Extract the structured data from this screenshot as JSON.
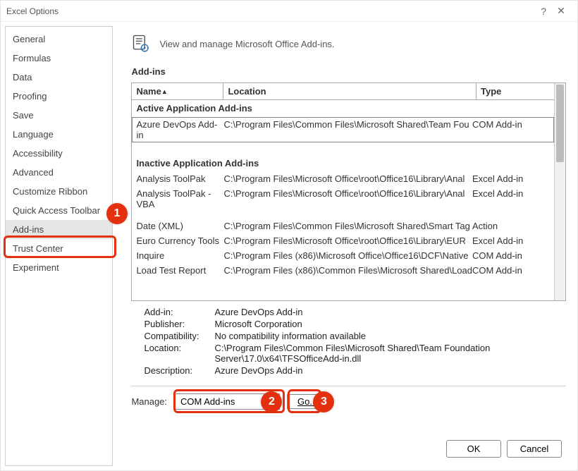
{
  "window": {
    "title": "Excel Options",
    "help_glyph": "?",
    "close_glyph": "✕"
  },
  "sidebar": {
    "items": [
      {
        "label": "General"
      },
      {
        "label": "Formulas"
      },
      {
        "label": "Data"
      },
      {
        "label": "Proofing"
      },
      {
        "label": "Save"
      },
      {
        "label": "Language"
      },
      {
        "label": "Accessibility"
      },
      {
        "label": "Advanced"
      },
      {
        "label": "Customize Ribbon"
      },
      {
        "label": "Quick Access Toolbar"
      },
      {
        "label": "Add-ins",
        "selected": true
      },
      {
        "label": "Trust Center"
      },
      {
        "label": "Experiment"
      }
    ]
  },
  "header": {
    "text": "View and manage Microsoft Office Add-ins."
  },
  "section_title": "Add-ins",
  "columns": {
    "name": "Name",
    "location": "Location",
    "type": "Type"
  },
  "groups": [
    {
      "title": "Active Application Add-ins",
      "rows": [
        {
          "name": "Azure DevOps Add-in",
          "location": "C:\\Program Files\\Common Files\\Microsoft Shared\\Team Fou",
          "type": "COM Add-in",
          "selected": true
        }
      ]
    },
    {
      "title": "Inactive Application Add-ins",
      "rows": [
        {
          "name": "Analysis ToolPak",
          "location": "C:\\Program Files\\Microsoft Office\\root\\Office16\\Library\\Anal",
          "type": "Excel Add-in"
        },
        {
          "name": "Analysis ToolPak - VBA",
          "location": "C:\\Program Files\\Microsoft Office\\root\\Office16\\Library\\Anal",
          "type": "Excel Add-in"
        },
        {
          "name": "Date (XML)",
          "location": "C:\\Program Files\\Common Files\\Microsoft Shared\\Smart Tag",
          "type": "Action"
        },
        {
          "name": "Euro Currency Tools",
          "location": "C:\\Program Files\\Microsoft Office\\root\\Office16\\Library\\EUR",
          "type": "Excel Add-in"
        },
        {
          "name": "Inquire",
          "location": "C:\\Program Files (x86)\\Microsoft Office\\Office16\\DCF\\Native",
          "type": "COM Add-in"
        },
        {
          "name": "Load Test Report",
          "location": "C:\\Program Files (x86)\\Common Files\\Microsoft Shared\\Load",
          "type": "COM Add-in"
        }
      ]
    }
  ],
  "details": {
    "rows": [
      {
        "label": "Add-in:",
        "value": "Azure DevOps Add-in"
      },
      {
        "label": "Publisher:",
        "value": "Microsoft Corporation"
      },
      {
        "label": "Compatibility:",
        "value": "No compatibility information available"
      },
      {
        "label": "Location:",
        "value": "C:\\Program Files\\Common Files\\Microsoft Shared\\Team Foundation Server\\17.0\\x64\\TFSOfficeAdd-in.dll"
      },
      {
        "label": "Description:",
        "value": "Azure DevOps Add-in"
      }
    ]
  },
  "manage": {
    "label": "Manage:",
    "selected": "COM Add-ins",
    "go_label": "Go..."
  },
  "footer": {
    "ok": "OK",
    "cancel": "Cancel"
  },
  "callouts": {
    "c1": "1",
    "c2": "2",
    "c3": "3"
  }
}
